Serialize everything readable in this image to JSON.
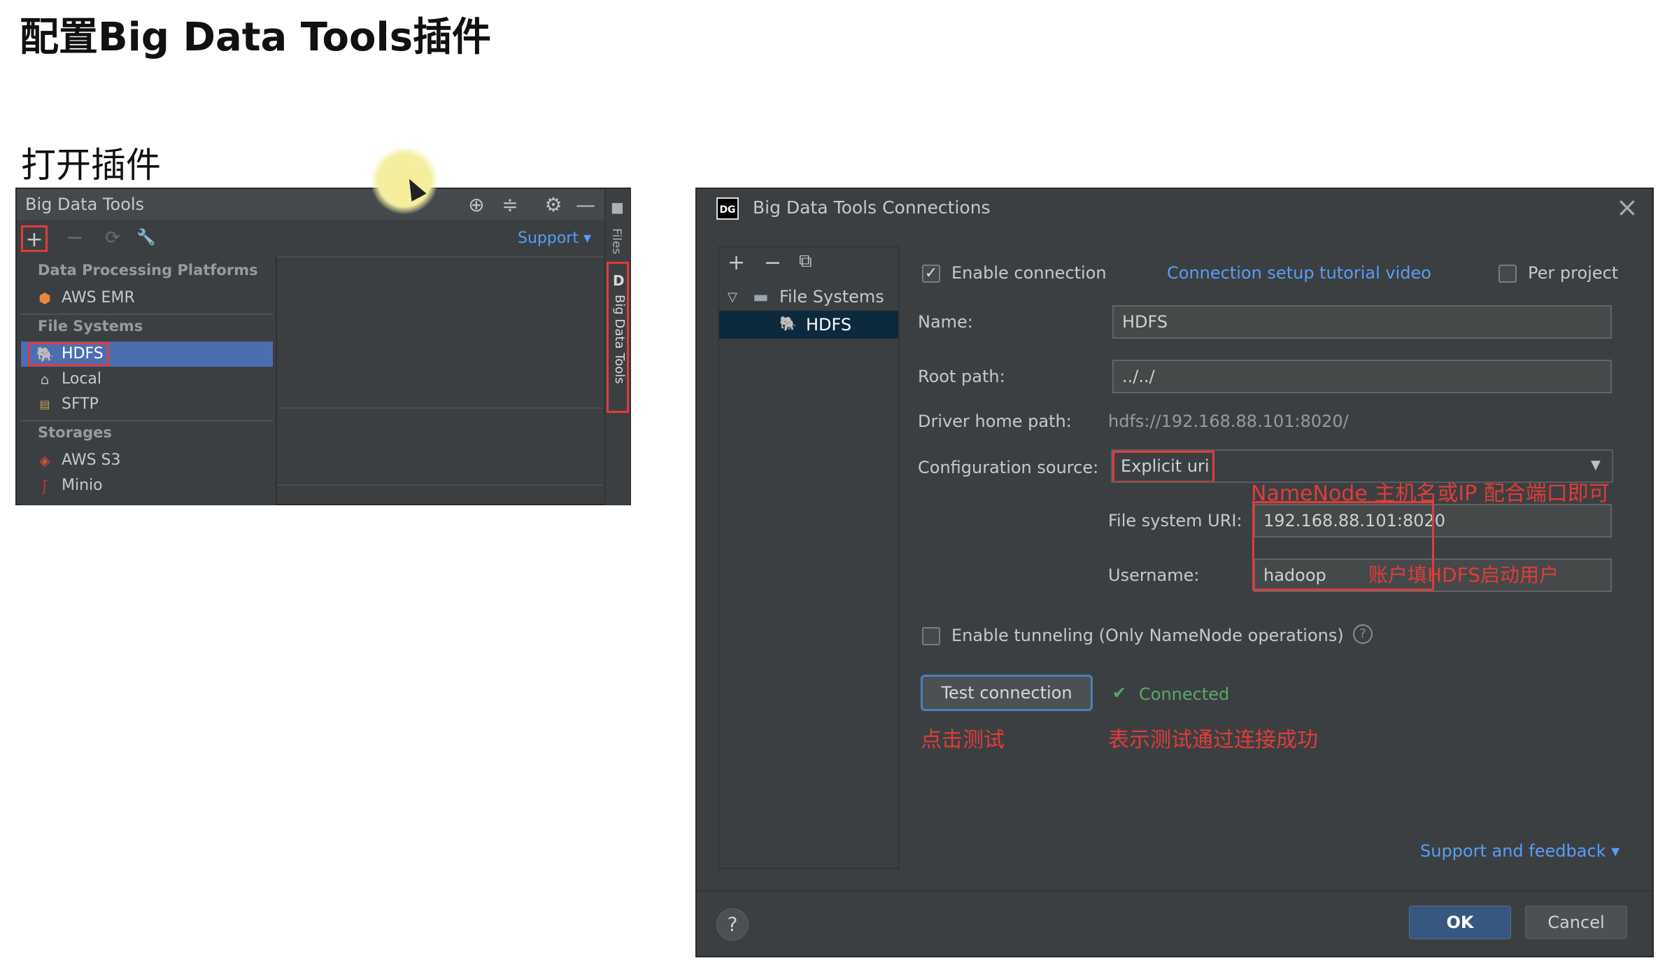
{
  "slide": {
    "title": "配置Big Data Tools插件",
    "subtitle": "打开插件"
  },
  "left_panel": {
    "title": "Big Data Tools",
    "header_icons": [
      "crosshair-icon",
      "collapse-icon",
      "gear-icon",
      "minimize-icon"
    ],
    "toolbar": {
      "add": "+",
      "remove": "−",
      "refresh": "⟳",
      "settings": "🔧",
      "support": "Support ▾"
    },
    "side_tabs": {
      "files": "Files",
      "bdt_letter": "D",
      "bdt": "Big Data Tools"
    },
    "dropdown": {
      "groups": [
        {
          "label": "Data Processing Platforms",
          "items": [
            {
              "label": "AWS EMR",
              "icon": "aws-emr-icon"
            }
          ]
        },
        {
          "label": "File Systems",
          "items": [
            {
              "label": "HDFS",
              "icon": "hdfs-icon",
              "selected": true
            },
            {
              "label": "Local",
              "icon": "home-icon"
            },
            {
              "label": "SFTP",
              "icon": "sftp-icon"
            }
          ]
        },
        {
          "label": "Storages",
          "items": [
            {
              "label": "AWS S3",
              "icon": "aws-s3-icon"
            },
            {
              "label": "Minio",
              "icon": "minio-icon"
            }
          ]
        }
      ]
    }
  },
  "dialog": {
    "title": "Big Data Tools Connections",
    "logo": "DG",
    "tree": {
      "toolbar": [
        "+",
        "−",
        "⧉"
      ],
      "root": "File Systems",
      "child": "HDFS"
    },
    "enable_connection": "Enable connection",
    "tutorial_link": "Connection setup tutorial video",
    "per_project": "Per project",
    "name_label": "Name:",
    "name_value": "HDFS",
    "root_path_label": "Root path:",
    "root_path_value": "../../",
    "driver_home_label": "Driver home path:",
    "driver_home_value": "hdfs://192.168.88.101:8020/",
    "config_source_label": "Configuration source:",
    "config_source_value": "Explicit uri",
    "fs_uri_label": "File system URI:",
    "fs_uri_value": "192.168.88.101:8020",
    "username_label": "Username:",
    "username_value": "hadoop",
    "tunneling_label": "Enable tunneling (Only NameNode operations)",
    "test_button": "Test connection",
    "connected_status": "Connected",
    "support_feedback": "Support and feedback ▾",
    "ok": "OK",
    "cancel": "Cancel",
    "help": "?"
  },
  "annotations": {
    "namenode_hint": "NameNode 主机名或IP 配合端口即可",
    "username_hint": "账户填HDFS启动用户",
    "click_test": "点击测试",
    "test_success": "表示测试通过连接成功"
  },
  "colors": {
    "ide_background": "#3c3f41",
    "selection_blue": "#4b6eaf",
    "link_blue": "#589df6",
    "annotation_red": "#e03c3c",
    "connected_green": "#59a869"
  }
}
